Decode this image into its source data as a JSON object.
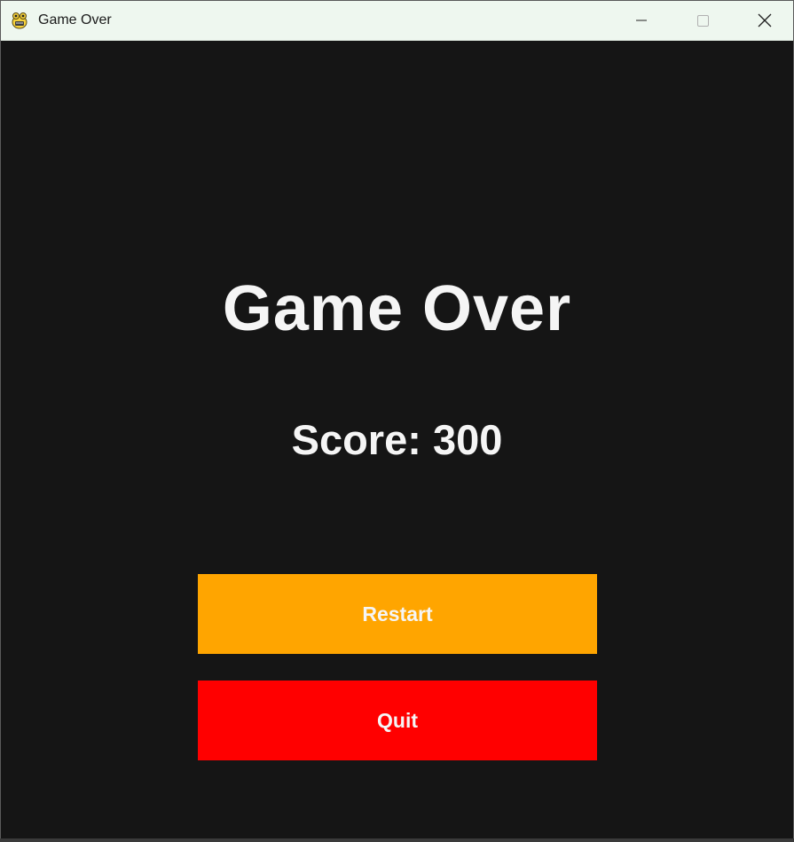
{
  "window": {
    "title": "Game Over",
    "app_icon": "pygame-snake-icon"
  },
  "controls": {
    "minimize_icon": "minimize-icon",
    "maximize_icon": "maximize-icon",
    "close_icon": "close-icon"
  },
  "game": {
    "heading": "Game Over",
    "score_text": "Score: 300",
    "score_value": 300,
    "background_color": "#151515",
    "text_color": "#f5f5f5"
  },
  "buttons": {
    "restart": {
      "label": "Restart",
      "color": "#ffa500"
    },
    "quit": {
      "label": "Quit",
      "color": "#ff0000"
    }
  }
}
